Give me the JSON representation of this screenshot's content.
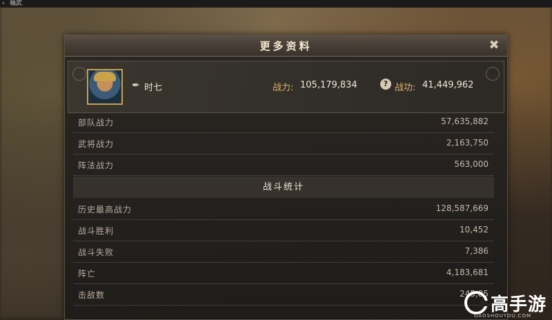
{
  "window": {
    "title": "福武",
    "back_icon": "back-arrow-icon"
  },
  "panel": {
    "title": "更多资料",
    "close_icon": "close-x-icon"
  },
  "profile": {
    "avatar_icon": "general-portrait-avatar",
    "edit_icon": "brush-icon",
    "name": "时七",
    "power_label": "战力:",
    "power_value": "105,179,834",
    "help_icon": "question-icon",
    "merit_label": "战功:",
    "merit_value": "41,449,962"
  },
  "power_rows": [
    {
      "label": "部队战力",
      "value": "57,635,882"
    },
    {
      "label": "武将战力",
      "value": "2,163,750"
    },
    {
      "label": "阵法战力",
      "value": "563,000"
    }
  ],
  "battle_stats": {
    "header": "战斗统计",
    "rows": [
      {
        "label": "历史最高战力",
        "value": "128,587,669"
      },
      {
        "label": "战斗胜利",
        "value": "10,452"
      },
      {
        "label": "战斗失败",
        "value": "7,386"
      },
      {
        "label": "阵亡",
        "value": "4,183,681"
      },
      {
        "label": "击敌数",
        "value": "245,85"
      }
    ]
  },
  "watermark": {
    "text": "高手游",
    "sub": "GAOSHOUYOU.COM"
  },
  "colors": {
    "accent_gold": "#e0b46a",
    "text_light": "#efe6d6",
    "frame": "#c9a24a"
  }
}
